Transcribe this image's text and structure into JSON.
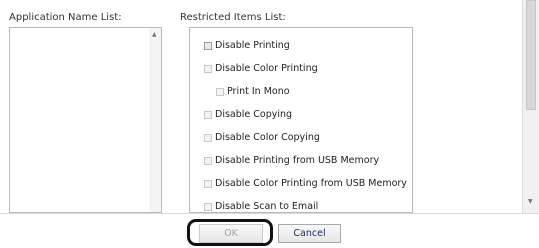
{
  "labels": {
    "application_list": "Application Name List:",
    "restricted_list": "Restricted Items List:"
  },
  "restricted_items": [
    {
      "label": "Disable Printing",
      "indent": false,
      "dark": true
    },
    {
      "label": "Disable Color Printing",
      "indent": false,
      "dark": false
    },
    {
      "label": "Print In Mono",
      "indent": true,
      "dark": false
    },
    {
      "label": "Disable Copying",
      "indent": false,
      "dark": false
    },
    {
      "label": "Disable Color Copying",
      "indent": false,
      "dark": false
    },
    {
      "label": "Disable Printing from USB Memory",
      "indent": false,
      "dark": false
    },
    {
      "label": "Disable Color Printing from USB Memory",
      "indent": false,
      "dark": false
    },
    {
      "label": "Disable Scan to Email",
      "indent": false,
      "dark": false
    }
  ],
  "buttons": {
    "ok": "OK",
    "cancel": "Cancel"
  }
}
